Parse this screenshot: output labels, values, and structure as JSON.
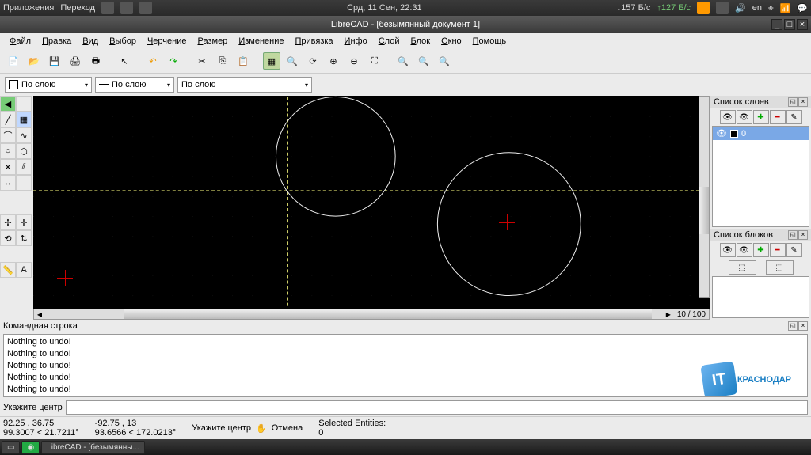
{
  "system": {
    "apps": "Приложения",
    "go": "Переход",
    "clock": "Срд, 11 Сен, 22:31",
    "net_down": "157 Б/с",
    "net_up": "127 Б/с",
    "lang": "en"
  },
  "title": "LibreCAD - [безымянный документ 1]",
  "menu": [
    "Файл",
    "Правка",
    "Вид",
    "Выбор",
    "Черчение",
    "Размер",
    "Изменение",
    "Привязка",
    "Инфо",
    "Слой",
    "Блок",
    "Окно",
    "Помощь"
  ],
  "props": {
    "color": "По слою",
    "width": "По слою",
    "ltype": "По слою"
  },
  "zoom": "10 / 100",
  "layers": {
    "title": "Список слоев",
    "items": [
      {
        "name": "0"
      }
    ]
  },
  "blocks": {
    "title": "Список блоков"
  },
  "cmd": {
    "title": "Командная строка",
    "log": [
      "Nothing to undo!",
      "Nothing to undo!",
      "Nothing to undo!",
      "Nothing to undo!",
      "Nothing to undo!"
    ],
    "prompt": "Укажите центр"
  },
  "status": {
    "a1": "92.25 , 36.75",
    "a2": "99.3007 < 21.7211°",
    "b1": "-92.75 , 13",
    "b2": "93.6566 < 172.0213°",
    "hint": "Укажите центр",
    "cancel": "Отмена",
    "sel": "Selected Entities:",
    "seln": "0"
  },
  "task": "LibreCAD - [безымянны...",
  "logo": "КРАСНОДАР"
}
